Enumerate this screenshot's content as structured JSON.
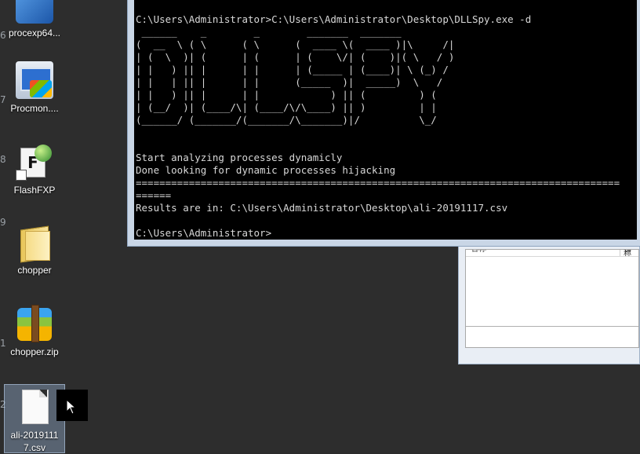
{
  "desktop": {
    "edge_digits": [
      "6",
      "7",
      "8",
      "9",
      "1",
      "2"
    ],
    "icons": [
      {
        "label": "procexp64...",
        "icon": "process-explorer-icon"
      },
      {
        "label": "Procmon....",
        "icon": "procmon-icon"
      },
      {
        "label": "FlashFXP",
        "icon": "flashfxp-icon"
      },
      {
        "label": "chopper",
        "icon": "folder-icon"
      },
      {
        "label": "chopper.zip",
        "icon": "zip-archive-icon"
      },
      {
        "label": "ali-2019111\n7.csv",
        "icon": "csv-file-icon"
      }
    ]
  },
  "console": {
    "lines": [
      "C:\\Users\\Administrator>C:\\Users\\Administrator\\Desktop\\DLLSpy.exe -d",
      " ______    _        _        _______  _______",
      "(  __  \\ ( \\      ( \\      (  ____ \\(  ____ )|\\     /|",
      "| (  \\  )| (      | (      | (    \\/| (    )|( \\   / )",
      "| |   ) || |      | |      | (_____ | (____)| \\ (_) /",
      "| |   | || |      | |      (_____  )|  _____)  \\   /",
      "| |   ) || |      | |            ) || (         ) (",
      "| (__/  )| (____/\\| (____/\\/\\____) || )         | |",
      "(______/ (_______/(_______/\\_______)|/          \\_/",
      "",
      "",
      "Start analyzing processes dynamicly",
      "Done looking for dynamic processes hijacking",
      "==================================================================================",
      "======",
      "Results are in: C:\\Users\\Administrator\\Desktop\\ali-20191117.csv",
      "",
      "C:\\Users\\Administrator>"
    ]
  },
  "background_window": {
    "columns": [
      "名称",
      "名称"
    ]
  },
  "colors": {
    "desktop": "#2d2d2d",
    "console_bg": "#000000",
    "console_text": "#d8d8d8",
    "window_frame": "#c9d6e6"
  }
}
